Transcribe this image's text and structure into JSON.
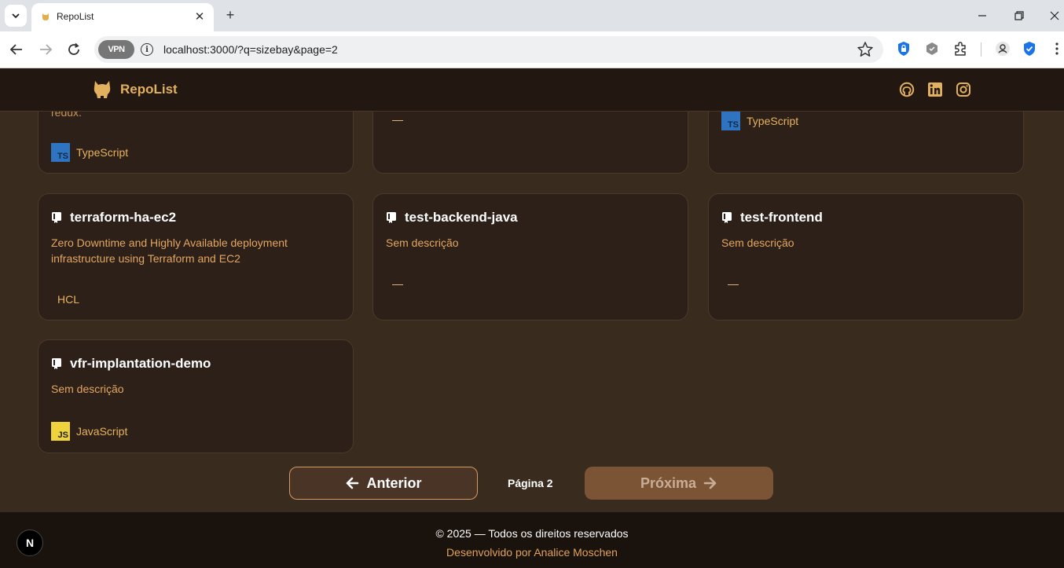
{
  "browser": {
    "tab_title": "RepoList",
    "url": "localhost:3000/?q=sizebay&page=2",
    "vpn_label": "VPN"
  },
  "header": {
    "logo_text": "RepoList",
    "social_icons": [
      "github-icon",
      "linkedin-icon",
      "instagram-icon"
    ]
  },
  "cards": [
    {
      "title": "",
      "description": "redux.",
      "language": "TypeScript",
      "lang_badge": "TS",
      "lang_color": "#2f74c0"
    },
    {
      "title": "",
      "description": "",
      "language": "",
      "no_lang": "—"
    },
    {
      "title": "",
      "description": "",
      "language": "TypeScript",
      "lang_badge": "TS",
      "lang_color": "#2f74c0"
    },
    {
      "title": "terraform-ha-ec2",
      "description": "Zero Downtime and Highly Available deployment infrastructure using Terraform and EC2",
      "language": "HCL"
    },
    {
      "title": "test-backend-java",
      "description": "Sem descrição",
      "language": "",
      "no_lang": "—"
    },
    {
      "title": "test-frontend",
      "description": "Sem descrição",
      "language": "",
      "no_lang": "—"
    },
    {
      "title": "vfr-implantation-demo",
      "description": "Sem descrição",
      "language": "JavaScript",
      "lang_badge": "JS",
      "lang_color": "#f0d33c"
    }
  ],
  "pagination": {
    "prev_label": "Anterior",
    "page_label": "Página 2",
    "next_label": "Próxima"
  },
  "footer": {
    "copyright": "© 2025 — Todos os direitos reservados",
    "developer": "Desenvolvido por Analice Moschen"
  },
  "colors": {
    "page_bg": "#3a2b1f",
    "card_bg": "#2c2019",
    "accent": "#e1b15f",
    "description": "#e3a662"
  }
}
